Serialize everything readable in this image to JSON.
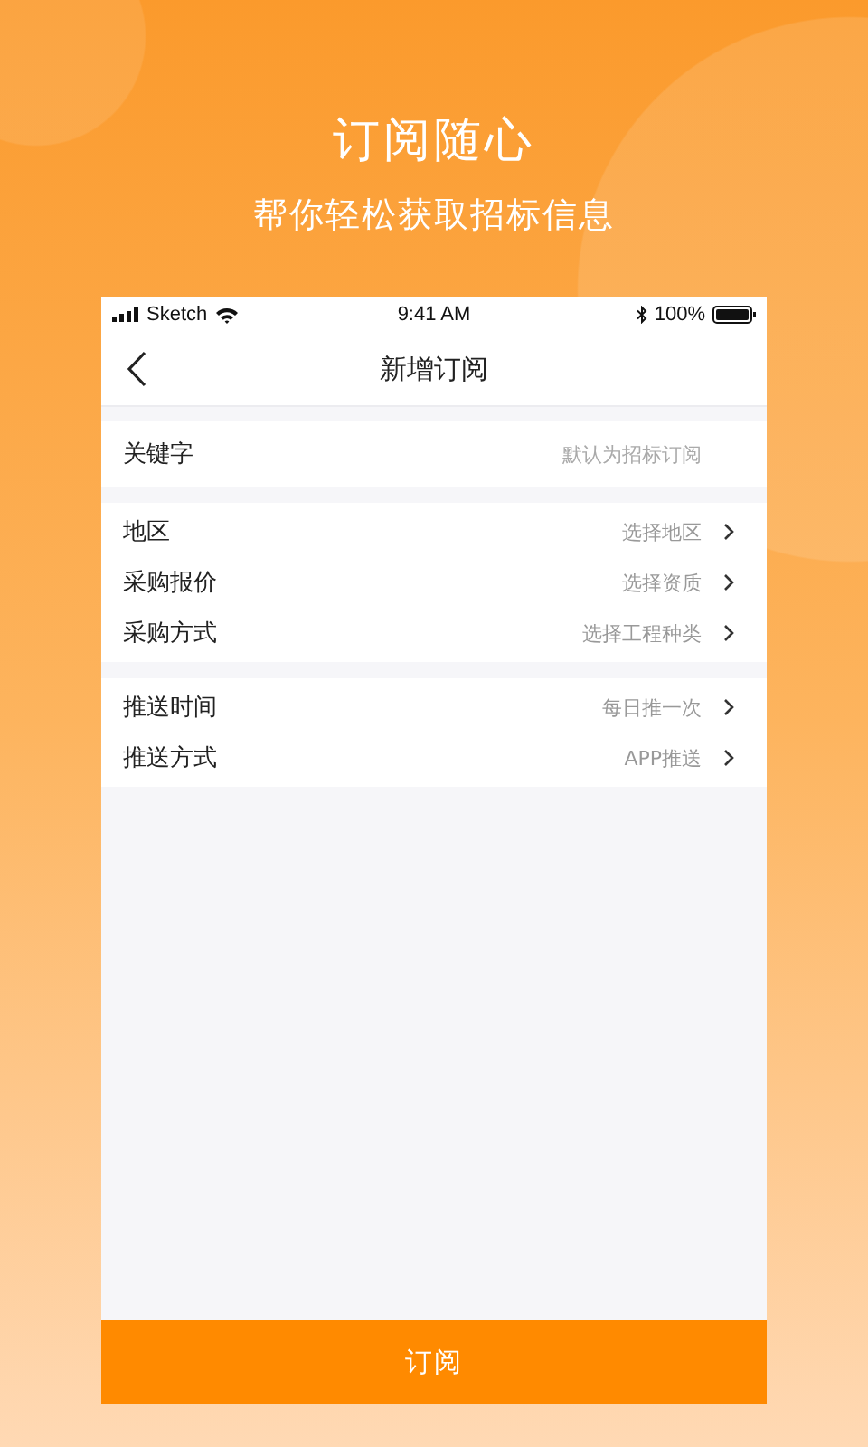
{
  "headline": "订阅随心",
  "subheadline": "帮你轻松获取招标信息",
  "status_bar": {
    "carrier": "Sketch",
    "time": "9:41 AM",
    "battery": "100%"
  },
  "nav": {
    "title": "新增订阅"
  },
  "sections": [
    {
      "rows": [
        {
          "kind": "input",
          "label": "关键字",
          "placeholder": "默认为招标订阅"
        }
      ]
    },
    {
      "rows": [
        {
          "kind": "select",
          "label": "地区",
          "value": "选择地区"
        },
        {
          "kind": "select",
          "label": "采购报价",
          "value": "选择资质"
        },
        {
          "kind": "select",
          "label": "采购方式",
          "value": "选择工程种类"
        }
      ]
    },
    {
      "rows": [
        {
          "kind": "select",
          "label": "推送时间",
          "value": "每日推一次"
        },
        {
          "kind": "select",
          "label": "推送方式",
          "value": "APP推送"
        }
      ]
    }
  ],
  "submit_button": "订阅"
}
